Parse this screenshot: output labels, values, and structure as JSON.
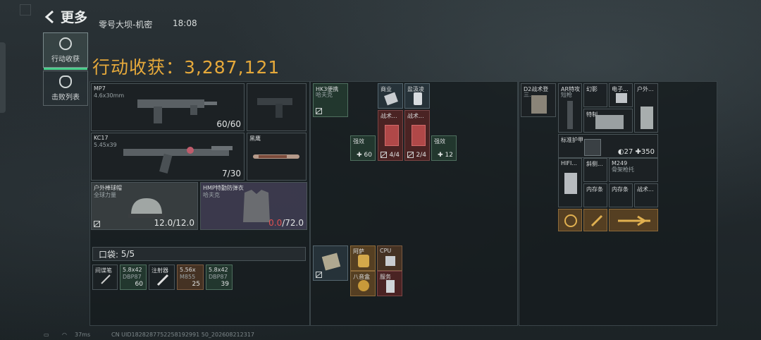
{
  "header": {
    "back_label": "更多",
    "map": "零号大坝-机密",
    "time": "18:08"
  },
  "tabs": [
    {
      "label": "行动收获"
    },
    {
      "label": "击败列表"
    }
  ],
  "summary": {
    "prefix": "行动收获：",
    "value": "3,287,121"
  },
  "weapons": [
    {
      "name": "MP7",
      "sub": "4.6x30mm",
      "count": "60/60"
    },
    {
      "name": "KC17",
      "sub": "5.45x39",
      "count": "7/30"
    }
  ],
  "side_items": [
    {
      "name": "黑鹰",
      "count": ""
    }
  ],
  "armor": [
    {
      "name": "户外棒球帽",
      "sub": "全球力量",
      "count": "12.0/12.0"
    },
    {
      "name": "HMP特勤防弹衣",
      "sub": "哈夫克",
      "count_a": "0.0",
      "count_b": "/72.0"
    }
  ],
  "pocket": {
    "label": "口袋:",
    "value": "5/5"
  },
  "pocket_items": [
    {
      "name": "间谍笔",
      "sub": "",
      "count": ""
    },
    {
      "name": "5.8x42",
      "sub": "DBP87",
      "count": "60"
    },
    {
      "name": "注射器",
      "sub": "",
      "count": ""
    },
    {
      "name": "5.56x",
      "sub": "M855",
      "count": "25"
    },
    {
      "name": "5.8x42",
      "sub": "DBP87",
      "count": "39"
    }
  ],
  "middle_items": [
    {
      "name": "HK3便携",
      "sub": "哈夫克",
      "count": ""
    },
    {
      "name": "商业",
      "count": ""
    },
    {
      "name": "盐汲凌",
      "count": ""
    },
    {
      "name": "战术...",
      "count": "4/4"
    },
    {
      "name": "战术...",
      "count": "2/4"
    },
    {
      "name": "强效",
      "count": "60"
    },
    {
      "name": "强效",
      "count": "12"
    }
  ],
  "mid_lower": [
    {
      "name": "",
      "count": ""
    },
    {
      "name": "阿萨",
      "count": ""
    },
    {
      "name": "CPU",
      "count": ""
    },
    {
      "name": "八音盒",
      "count": ""
    },
    {
      "name": "服务",
      "count": ""
    }
  ],
  "right_items": [
    {
      "name": "D2战术登",
      "sub": "三..."
    },
    {
      "name": "AR特攻",
      "sub": "短枪"
    },
    {
      "name": "幻影"
    },
    {
      "name": "电子..."
    },
    {
      "name": "户外..."
    },
    {
      "name": "特制..."
    },
    {
      "name": "标准护甲"
    },
    {
      "name": "HIFI..."
    },
    {
      "name": "斜侧..."
    },
    {
      "name": "M249",
      "sub": "骨架枪托"
    },
    {
      "name": "内存条"
    },
    {
      "name": "内存条"
    },
    {
      "name": "战术..."
    }
  ],
  "armor_stats": {
    "armor": "27",
    "heal": "350"
  },
  "footer": {
    "ping": "37ms",
    "uid": "CN UID1828287752258192991 50_202608212317"
  },
  "colors": {
    "accent": "#e6a93b",
    "tab_active": "#4bd08c",
    "red": "#e05252"
  }
}
